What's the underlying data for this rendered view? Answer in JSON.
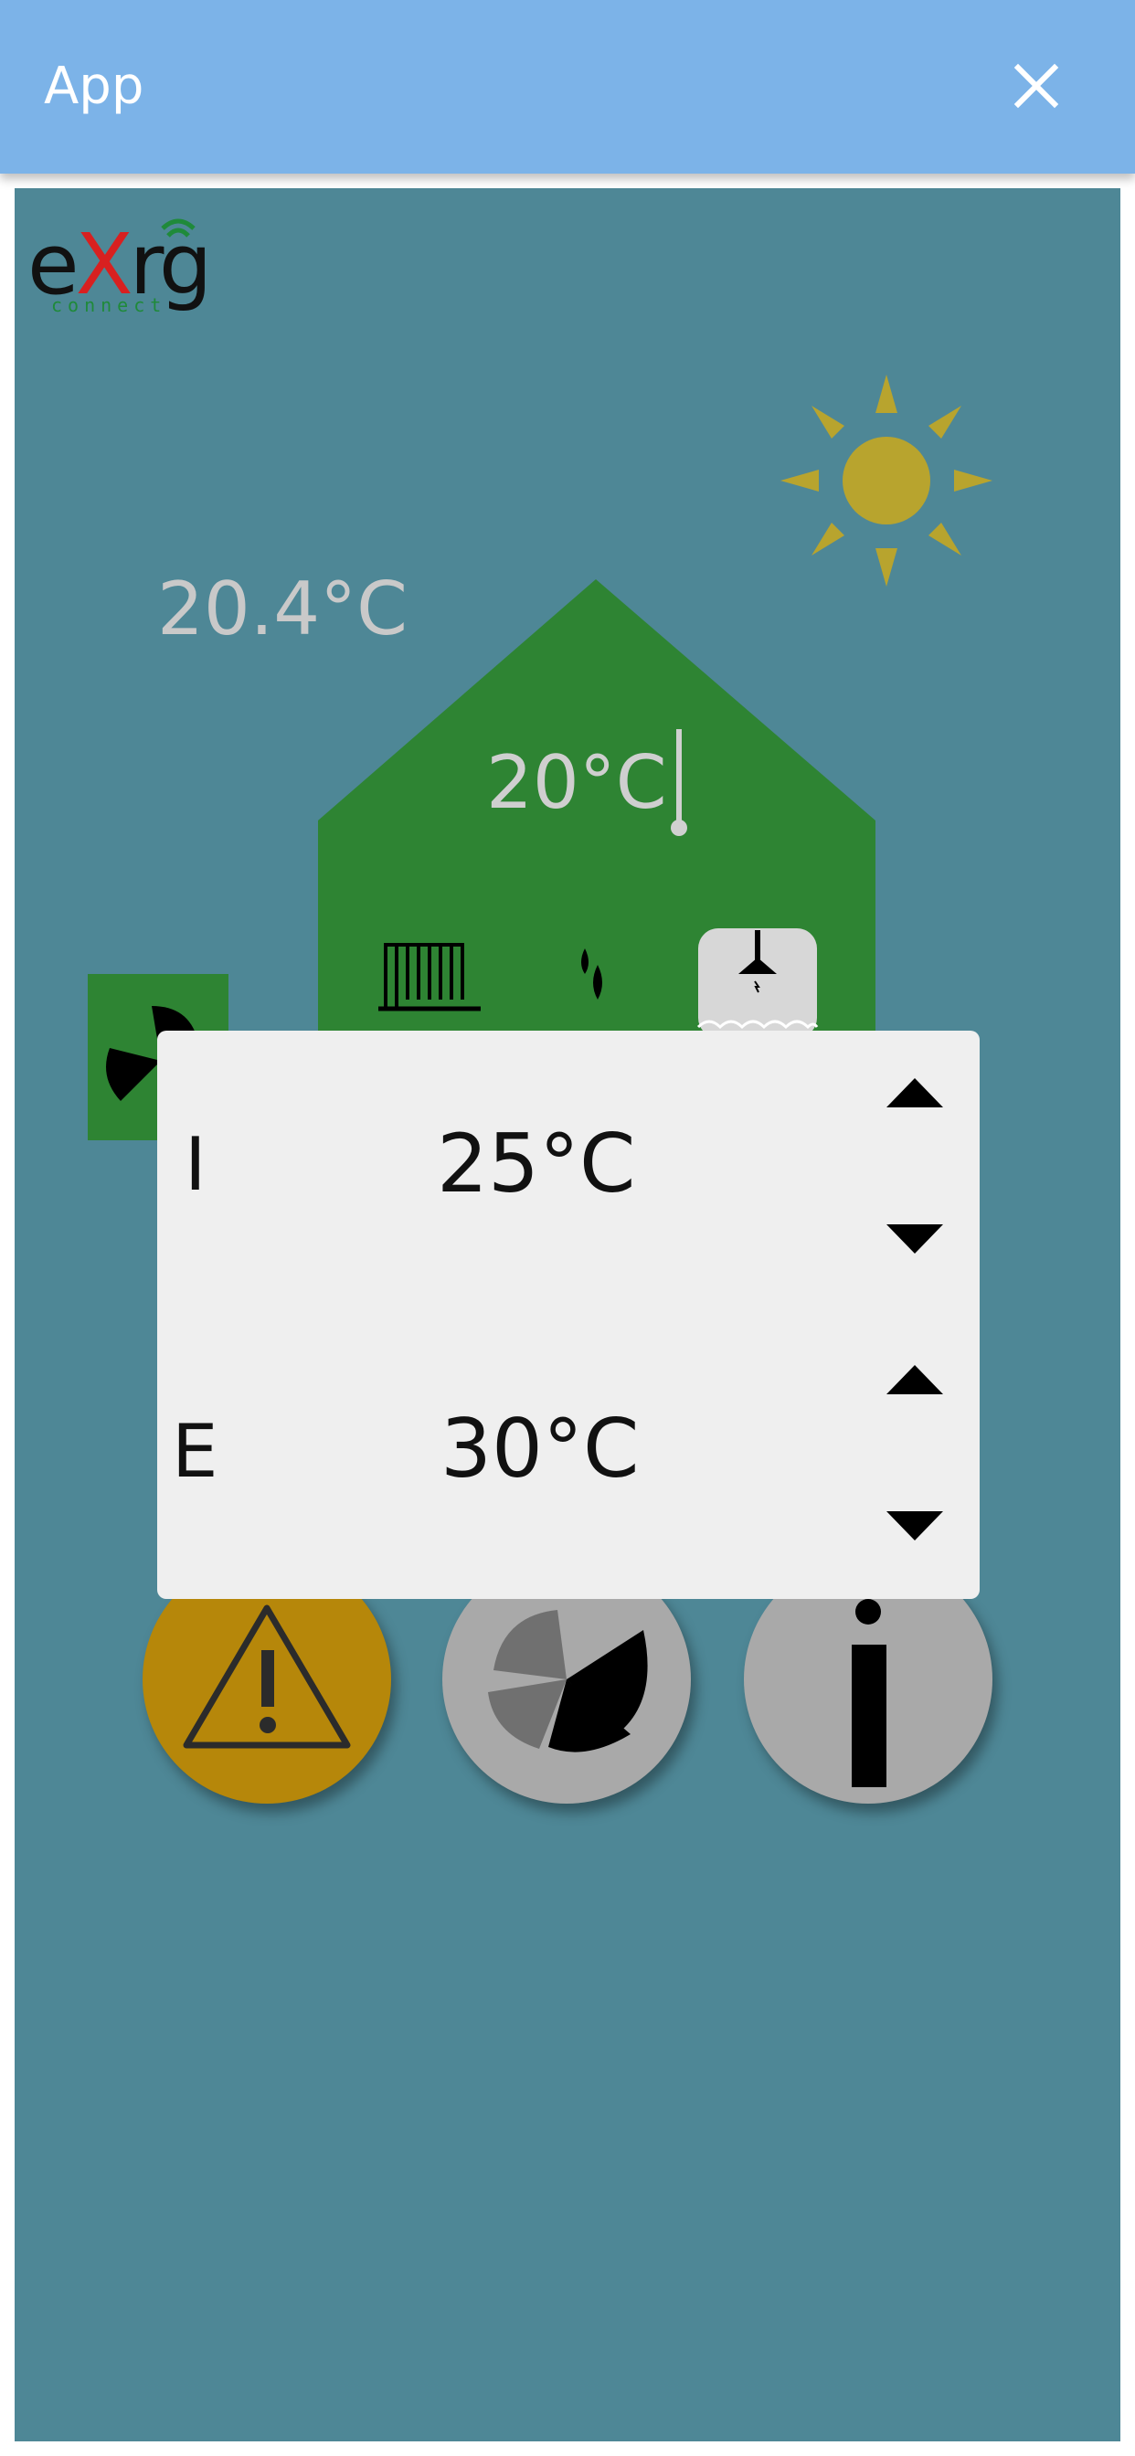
{
  "appbar": {
    "title": "App",
    "close_icon": "close-icon",
    "background": "#7cb3e8"
  },
  "logo": {
    "main_prefix": "e",
    "main_x": "X",
    "main_suffix": "rg",
    "sub": "connect"
  },
  "weather": {
    "icon": "sun-icon",
    "outdoor_temp": "20.4°C"
  },
  "house": {
    "indoor_temp": "20°C",
    "thermometer_icon": "thermometer-icon",
    "radiator_icon": "radiator-icon",
    "drops_icon": "water-drops-icon",
    "tank_icon": "hot-water-tank-icon",
    "color": "#2e8433"
  },
  "fan_indicator": {
    "icon": "fan-icon"
  },
  "dialog": {
    "rows": [
      {
        "label": "I",
        "value": "25°C"
      },
      {
        "label": "E",
        "value": "30°C"
      }
    ]
  },
  "buttons": {
    "warning": "warning-icon",
    "fan": "fan-icon",
    "info": "info-icon",
    "warning_color": "#b6870a",
    "neutral_color": "#a9a9a9"
  },
  "colors": {
    "panel": "#4e8796",
    "sun": "#b8a42e"
  }
}
